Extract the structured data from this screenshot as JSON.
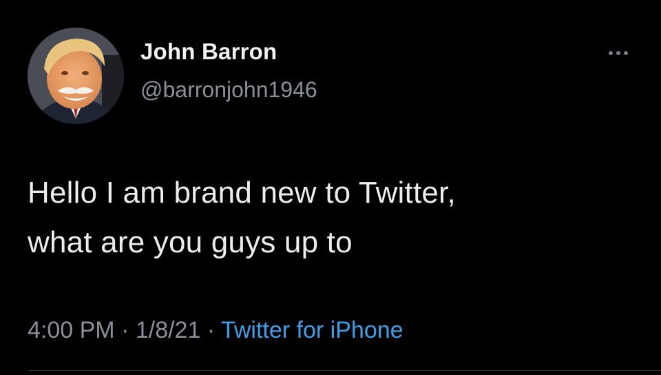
{
  "user": {
    "display_name": "John Barron",
    "handle": "@barronjohn1946",
    "avatar_icon": "profile-photo"
  },
  "more_icon": "more-options-icon",
  "tweet": {
    "line1": "Hello I am brand new to Twitter,",
    "line2": "what are you guys up to"
  },
  "meta": {
    "time": "4:00 PM",
    "sep1": " · ",
    "date": "1/8/21",
    "sep2": " · ",
    "source": "Twitter for iPhone"
  },
  "colors": {
    "background": "#000000",
    "text": "#ececec",
    "secondary": "#8a9099",
    "link": "#3ea0e8"
  }
}
